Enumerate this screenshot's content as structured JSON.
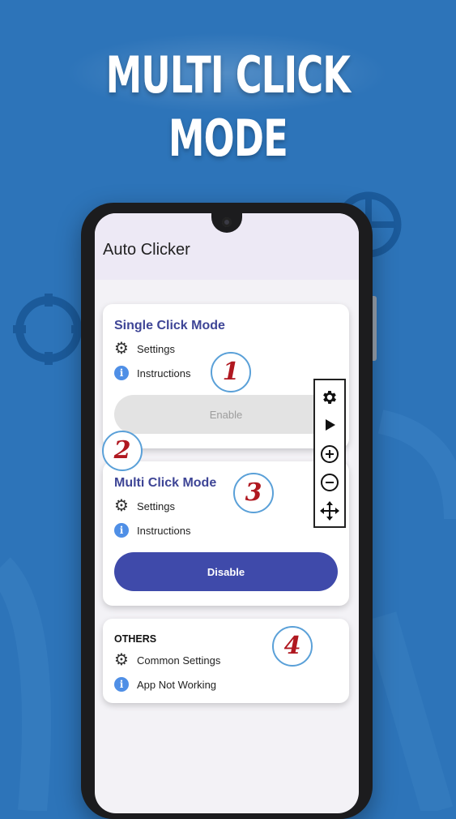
{
  "banner": {
    "title": "MULTI CLICK MODE"
  },
  "appbar": {
    "title": "Auto Clicker"
  },
  "single_card": {
    "title": "Single Click Mode",
    "settings_label": "Settings",
    "instructions_label": "Instructions",
    "button_label": "Enable",
    "button_state": "disabled"
  },
  "multi_card": {
    "title": "Multi Click Mode",
    "settings_label": "Settings",
    "instructions_label": "Instructions",
    "button_label": "Disable",
    "button_state": "enabled"
  },
  "others_card": {
    "heading": "OTHERS",
    "common_settings_label": "Common Settings",
    "app_not_working_label": "App Not Working"
  },
  "badges": [
    "1",
    "2",
    "3",
    "4"
  ],
  "float_panel": {
    "icons": [
      "gear-icon",
      "play-icon",
      "zoom-in-icon",
      "zoom-out-icon",
      "move-icon"
    ]
  },
  "icons": {
    "settings": "gear-icon",
    "info": "info-icon"
  },
  "colors": {
    "background": "#2d74b9",
    "card_title": "#3e4596",
    "primary_button": "#3f4aaa",
    "disabled_button": "#e3e3e3",
    "badge_number": "#b01820",
    "info_icon": "#4f8fe6"
  }
}
